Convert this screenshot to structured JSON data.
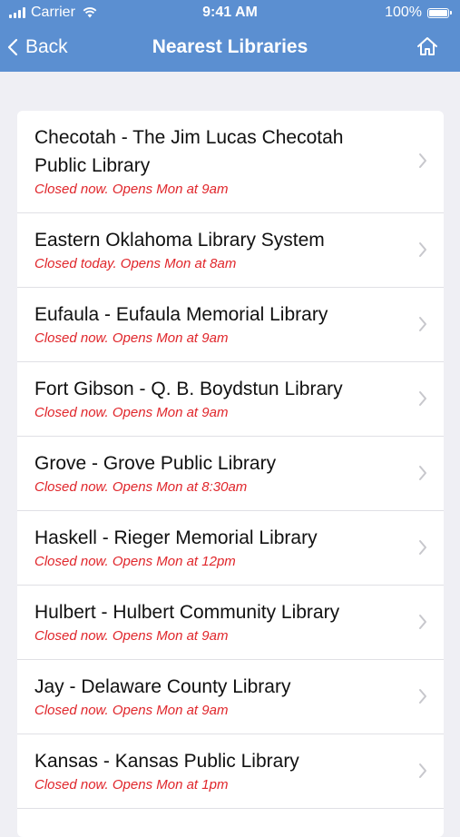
{
  "status_bar": {
    "carrier": "Carrier",
    "time": "9:41 AM",
    "battery": "100%"
  },
  "nav": {
    "back_label": "Back",
    "title": "Nearest Libraries"
  },
  "libraries": [
    {
      "name": "Checotah - The Jim Lucas Checotah Public Library",
      "hours": "Closed now. Opens Mon at 9am"
    },
    {
      "name": "Eastern Oklahoma Library System",
      "hours": "Closed today. Opens Mon at 8am"
    },
    {
      "name": "Eufaula - Eufaula Memorial Library",
      "hours": "Closed now. Opens Mon at 9am"
    },
    {
      "name": "Fort Gibson - Q. B. Boydstun Library",
      "hours": "Closed now. Opens Mon at 9am"
    },
    {
      "name": "Grove - Grove Public Library",
      "hours": "Closed now. Opens Mon at 8:30am"
    },
    {
      "name": "Haskell - Rieger Memorial Library",
      "hours": "Closed now. Opens Mon at 12pm"
    },
    {
      "name": "Hulbert - Hulbert Community Library",
      "hours": "Closed now. Opens Mon at 9am"
    },
    {
      "name": "Jay - Delaware County Library",
      "hours": "Closed now. Opens Mon at 9am"
    },
    {
      "name": "Kansas - Kansas Public Library",
      "hours": "Closed now. Opens Mon at 1pm"
    }
  ],
  "colors": {
    "header": "#5b8fd1",
    "hours_text": "#e0262b",
    "background": "#efeff4"
  }
}
